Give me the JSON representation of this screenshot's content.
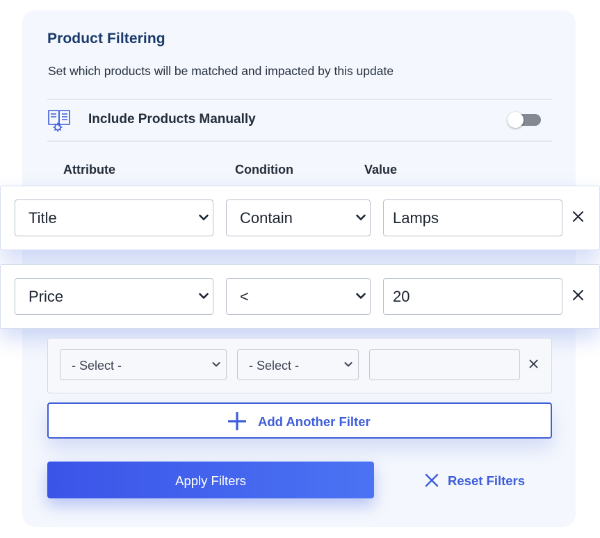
{
  "panel": {
    "title": "Product Filtering",
    "subtitle": "Set which products will be matched and impacted by this update"
  },
  "manual": {
    "label": "Include Products Manually",
    "toggle_on": false,
    "icon": "book-gear-icon"
  },
  "columns": {
    "attribute": "Attribute",
    "condition": "Condition",
    "value": "Value"
  },
  "filters": [
    {
      "attribute": "Title",
      "condition": "Contain",
      "value": "Lamps"
    },
    {
      "attribute": "Price",
      "condition": "<",
      "value": "20"
    },
    {
      "attribute": "- Select -",
      "condition": "- Select -",
      "value": ""
    }
  ],
  "actions": {
    "add_label": "Add Another Filter",
    "apply_label": "Apply Filters",
    "reset_label": "Reset Filters"
  },
  "colors": {
    "accent": "#3e5ed8",
    "title": "#1a3a6b",
    "panel_bg": "#f4f7fd"
  }
}
